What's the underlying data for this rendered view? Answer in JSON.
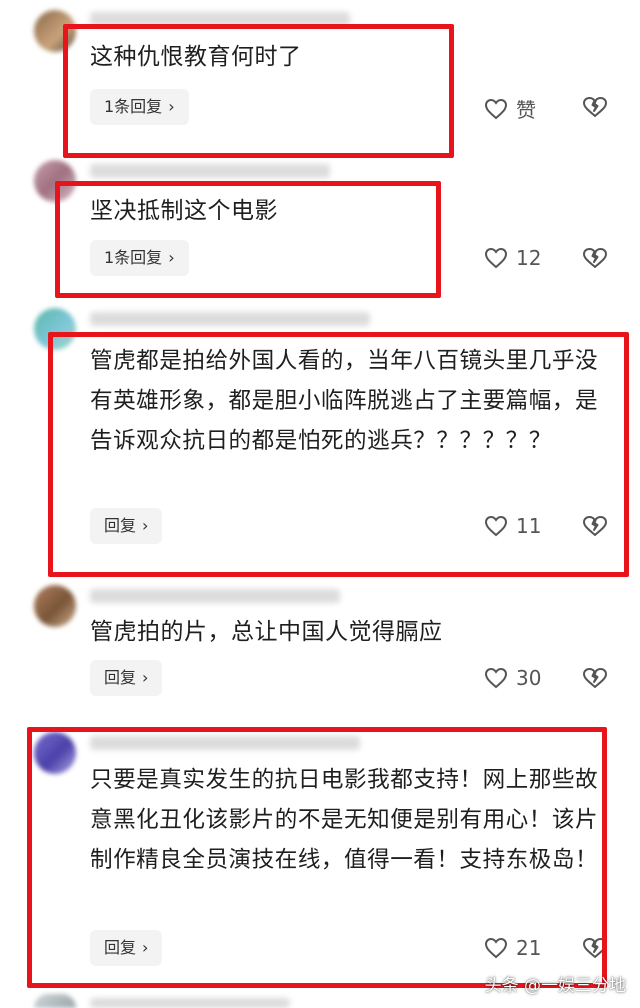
{
  "comments": [
    {
      "text": "这种仇恨教育何时了",
      "reply": "1条回复",
      "likes": "赞"
    },
    {
      "text": "坚决抵制这个电影",
      "reply": "1条回复",
      "likes": "12"
    },
    {
      "text": "管虎都是拍给外国人看的，当年八百镜头里几乎没有英雄形象，都是胆小临阵脱逃占了主要篇幅，是告诉观众抗日的都是怕死的逃兵？？？？？？",
      "reply": "回复",
      "likes": "11"
    },
    {
      "text": "管虎拍的片，总让中国人觉得膈应",
      "reply": "回复",
      "likes": "30"
    },
    {
      "text": "只要是真实发生的抗日电影我都支持！网上那些故意黑化丑化该影片的不是无知便是别有用心！该片制作精良全员演技在线，值得一看！支持东极岛！",
      "reply": "回复",
      "likes": "21"
    }
  ],
  "watermark": "头条 @一娱三分地",
  "colors": {
    "highlight_box": "#e8141b",
    "pill_bg": "#f3f3f3"
  }
}
